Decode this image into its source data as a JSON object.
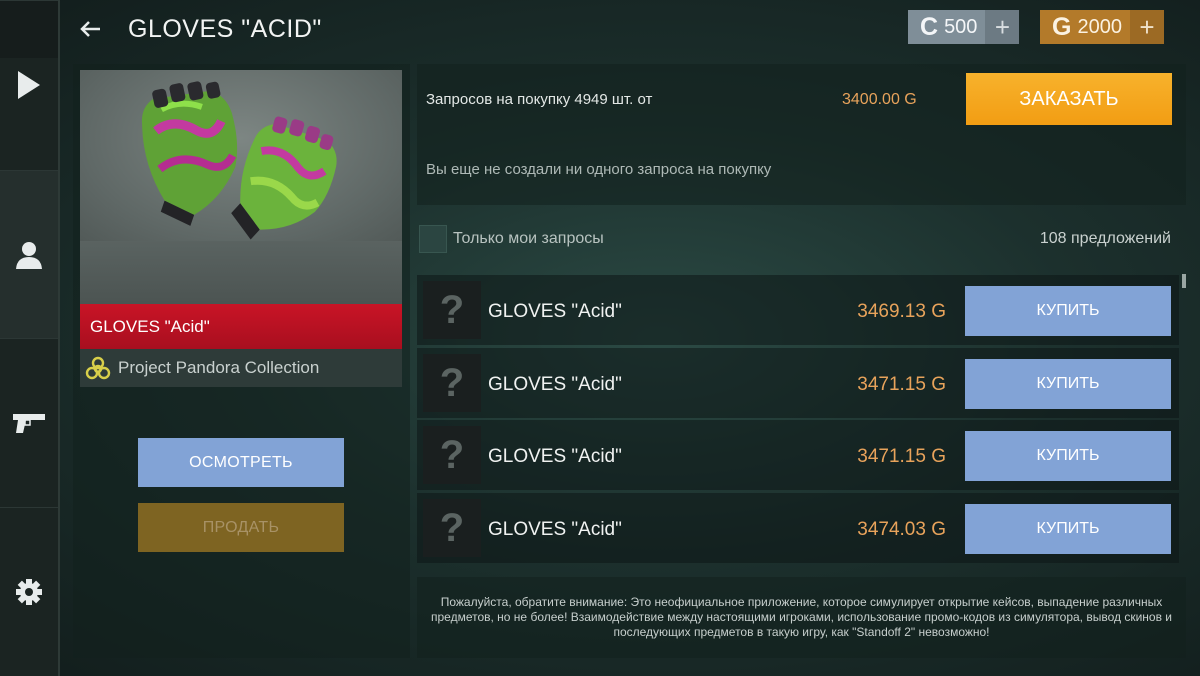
{
  "header": {
    "title": "GLOVES \"ACID\"",
    "currency_c": {
      "symbol": "C",
      "amount": "500",
      "plus": "+"
    },
    "currency_g": {
      "symbol": "G",
      "amount": "2000",
      "plus": "+"
    }
  },
  "sidebar": {
    "items": [
      {
        "icon": "play-icon"
      },
      {
        "icon": "user-icon"
      },
      {
        "icon": "pistol-icon"
      },
      {
        "icon": "gear-icon"
      }
    ]
  },
  "item": {
    "name": "GLOVES \"Acid\"",
    "collection": "Project Pandora Collection",
    "inspect_label": "ОСМОТРЕТЬ",
    "sell_label": "ПРОДАТЬ"
  },
  "request": {
    "text": "Запросов на покупку 4949 шт. от",
    "price": "3400.00 G",
    "order_label": "ЗАКАЗАТЬ",
    "empty_text": "Вы еще не создали ни одного запроса на покупку"
  },
  "filter": {
    "label": "Только мои запросы",
    "offers_count": "108 предложений"
  },
  "listings": [
    {
      "thumb": "?",
      "name": "GLOVES \"Acid\"",
      "price": "3469.13 G",
      "buy_label": "КУПИТЬ"
    },
    {
      "thumb": "?",
      "name": "GLOVES \"Acid\"",
      "price": "3471.15 G",
      "buy_label": "КУПИТЬ"
    },
    {
      "thumb": "?",
      "name": "GLOVES \"Acid\"",
      "price": "3471.15 G",
      "buy_label": "КУПИТЬ"
    },
    {
      "thumb": "?",
      "name": "GLOVES \"Acid\"",
      "price": "3474.03 G",
      "buy_label": "КУПИТЬ"
    }
  ],
  "disclaimer": "Пожалуйста, обратите внимание: Это неофициальное приложение, которое симулирует открытие кейсов, выпадение различных предметов, но не более! Взаимодействие между настоящими игроками, использование промо-кодов из симулятора, вывод скинов и последующих предметов в такую игру, как \"Standoff 2\" невозможно!",
  "colors": {
    "accent_orange": "#f29d13",
    "price_orange": "#e8a35b",
    "button_blue": "#82a3d6",
    "rarity_red": "#c91426"
  }
}
